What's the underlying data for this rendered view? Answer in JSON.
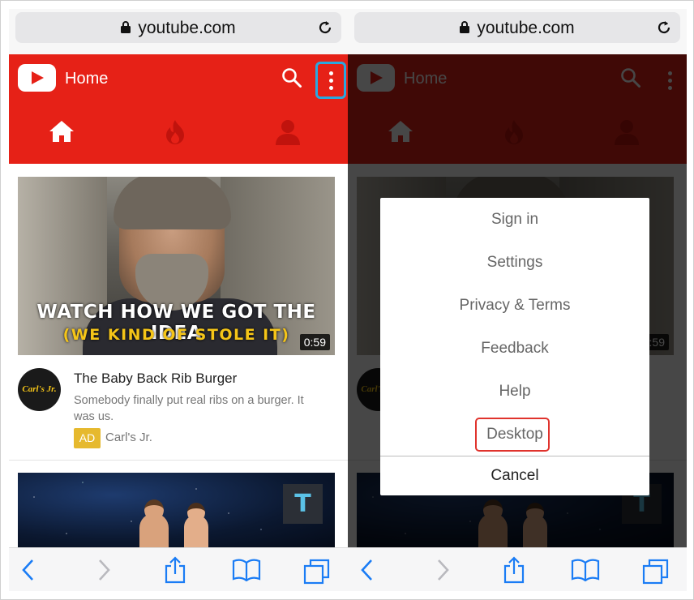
{
  "browser": {
    "url": "youtube.com"
  },
  "youtube": {
    "header_title": "Home",
    "tabs": [
      "Home",
      "Trending",
      "Account"
    ],
    "video": {
      "caption_line1": "WATCH HOW WE GOT THE IDEA",
      "caption_line2": "(WE KIND OF STOLE IT)",
      "duration": "0:59",
      "title": "The Baby Back Rib Burger",
      "description": "Somebody finally put real ribs on a burger. It was us.",
      "ad_badge": "AD",
      "channel": "Carl's Jr.",
      "channel_logo_text": "Carl's Jr."
    },
    "video2": {
      "badge": "T"
    }
  },
  "menu": {
    "items": [
      "Sign in",
      "Settings",
      "Privacy & Terms",
      "Feedback",
      "Help",
      "Desktop"
    ],
    "cancel": "Cancel"
  },
  "colors": {
    "youtube_red": "#e62117",
    "highlight_blue": "#29a8e0",
    "highlight_red": "#e0332d",
    "ios_blue": "#1a7cf5"
  }
}
